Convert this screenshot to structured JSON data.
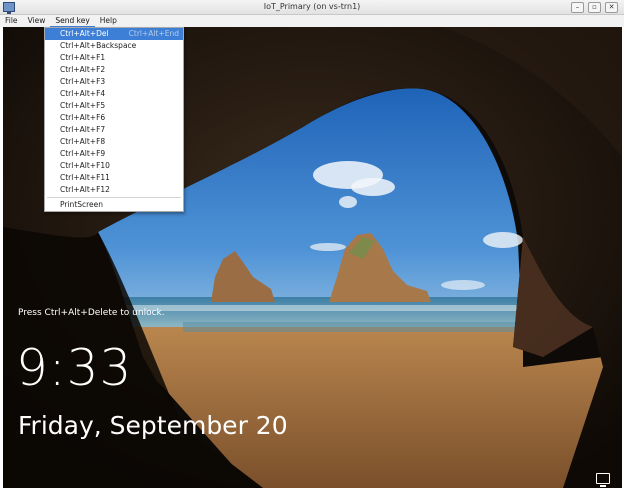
{
  "window": {
    "title": "IoT_Primary (on vs-trn1)",
    "controls": [
      "–",
      "▫",
      "✕"
    ]
  },
  "menu": [
    "File",
    "View",
    "Send key",
    "Help"
  ],
  "send_key_menu": {
    "highlighted": {
      "label": "Ctrl+Alt+Del",
      "accelerator": "Ctrl+Alt+End"
    },
    "items": [
      "Ctrl+Alt+Backspace",
      "Ctrl+Alt+F1",
      "Ctrl+Alt+F2",
      "Ctrl+Alt+F3",
      "Ctrl+Alt+F4",
      "Ctrl+Alt+F5",
      "Ctrl+Alt+F6",
      "Ctrl+Alt+F7",
      "Ctrl+Alt+F8",
      "Ctrl+Alt+F9",
      "Ctrl+Alt+F10",
      "Ctrl+Alt+F11",
      "Ctrl+Alt+F12"
    ],
    "last_item": "PrintScreen"
  },
  "lock_screen": {
    "unlock_hint": "Press Ctrl+Alt+Delete to unlock.",
    "time": "9:33",
    "date": "Friday, September 20"
  },
  "icons": {
    "app": "vm-viewer-icon",
    "network": "monitor-icon",
    "pointer": "mouse-cursor-icon"
  }
}
